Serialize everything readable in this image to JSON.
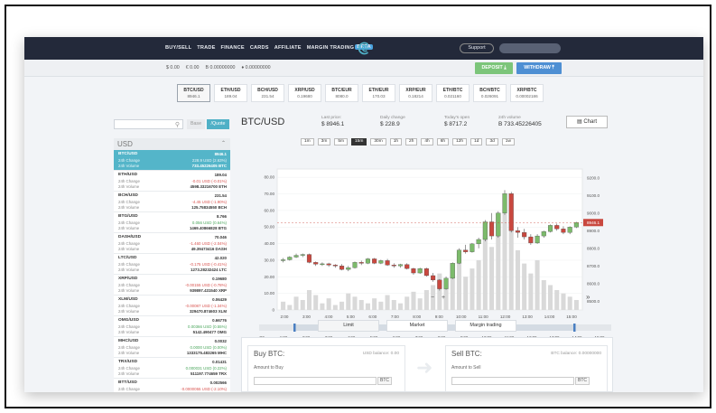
{
  "nav": {
    "items": [
      "BUY/SELL",
      "TRADE",
      "FINANCE",
      "CARDS",
      "AFFILIATE",
      "MARGIN TRADING"
    ],
    "beta": "BETA",
    "support": "Support"
  },
  "balances": [
    "$ 0.00",
    "€ 0.00",
    "B 0.00000000",
    "♦ 0.00000000"
  ],
  "deposit_label": "DEPOSIT",
  "withdraw_label": "WITHDRAW",
  "pairs": [
    {
      "name": "BTC/USD",
      "price": "8946.1"
    },
    {
      "name": "ETH/USD",
      "price": "189.04"
    },
    {
      "name": "BCH/USD",
      "price": "231.54"
    },
    {
      "name": "XRP/USD",
      "price": "0.19680"
    },
    {
      "name": "BTC/EUR",
      "price": "8080.0"
    },
    {
      "name": "ETH/EUR",
      "price": "170.03"
    },
    {
      "name": "XRP/EUR",
      "price": "0.18214"
    },
    {
      "name": "ETH/BTC",
      "price": "0.021160"
    },
    {
      "name": "BCH/BTC",
      "price": "0.026091"
    },
    {
      "name": "XRP/BTC",
      "price": "0.00002186"
    }
  ],
  "filter": {
    "base": "Base",
    "quote": "/Quote"
  },
  "market": {
    "header": "USD",
    "change_label": "24h Change",
    "volume_label": "24h Volume",
    "rows": [
      {
        "sym": "BTC/USD",
        "price": "8946.1",
        "chg": "228.9 USD (2.63%)",
        "vol": "733.45226405 BTC",
        "dir": "up"
      },
      {
        "sym": "ETH/USD",
        "price": "189.04",
        "chg": "-0.01 USD (-0.01%)",
        "vol": "4598.33216700 ETH",
        "dir": "down"
      },
      {
        "sym": "BCH/USD",
        "price": "231.54",
        "chg": "-4.45 USD (-1.90%)",
        "vol": "125.75834550 BCH",
        "dir": "down"
      },
      {
        "sym": "BTG/USD",
        "price": "8.766",
        "chg": "0.056 USD (0.64%)",
        "vol": "1469.40866828 BTG",
        "dir": "up"
      },
      {
        "sym": "DASH/USD",
        "price": "70.046",
        "chg": "-1.460 USD (-2.04%)",
        "vol": "49.39473416 DASH",
        "dir": "down"
      },
      {
        "sym": "LTC/USD",
        "price": "42.020",
        "chg": "-0.175 USD (-0.41%)",
        "vol": "1273.28232424 LTC",
        "dir": "down"
      },
      {
        "sym": "XRP/USD",
        "price": "0.19680",
        "chg": "-0.00155 USD (-0.78%)",
        "vol": "939897.431540 XRP",
        "dir": "down"
      },
      {
        "sym": "XLM/USD",
        "price": "0.06429",
        "chg": "-0.00087 USD (-1.34%)",
        "vol": "329470.874603 XLM",
        "dir": "down"
      },
      {
        "sym": "OMG/USD",
        "price": "0.66776",
        "chg": "0.00366 USD (0.55%)",
        "vol": "5142.490477 OMG",
        "dir": "up"
      },
      {
        "sym": "MHC/USD",
        "price": "0.0032",
        "chg": "0.0000 USD (0.00%)",
        "vol": "1333175.483265 MHC",
        "dir": "up"
      },
      {
        "sym": "TRX/USD",
        "price": "0.01431",
        "chg": "0.000031 USD (0.22%)",
        "vol": "511197.774659 TRX",
        "dir": "up"
      },
      {
        "sym": "BTT/USD",
        "price": "0.002566",
        "chg": "-0.0000055 USD (-2.10%)",
        "vol": "",
        "dir": "down"
      }
    ]
  },
  "ticker": {
    "title": "BTC/USD",
    "last_label": "Last price:",
    "last": "$ 8946.1",
    "daily_label": "Daily change",
    "daily": "$ 228.9",
    "open_label": "Today's open",
    "open": "$ 8717.2",
    "vol_label": "24h volume",
    "vol": "B 733.45226405",
    "chart_btn": "Chart"
  },
  "timeframes": [
    "1m",
    "3m",
    "5m",
    "15m",
    "30m",
    "1h",
    "2h",
    "4h",
    "6h",
    "12h",
    "1d",
    "3d",
    "1w"
  ],
  "active_timeframe": "15m",
  "chart_data": {
    "type": "candlestick",
    "left_axis_ticks": [
      "80.00",
      "70.00",
      "60.00",
      "50.00",
      "40.00",
      "30.00",
      "20.00",
      "10.00",
      "0"
    ],
    "right_axis_ticks": [
      "9200.0",
      "9100.0",
      "9000.0",
      "8900.0",
      "8800.0",
      "8700.0",
      "8600.0",
      "8500.0"
    ],
    "time_ticks": [
      "2:00",
      "3:00",
      "4:00",
      "5:00",
      "6:00",
      "7:00",
      "8:00",
      "9:00",
      "10:00",
      "11:00",
      "12:00",
      "13:00",
      "14:00",
      "15:00"
    ],
    "nav_ticks": [
      "-:00",
      "1:00",
      "2:00",
      "3:00",
      "4:00",
      "5:00",
      "6:00",
      "7:00",
      "8:00",
      "9:00",
      "10:00",
      "11:00",
      "12:00",
      "13:00",
      "14:00",
      "15:00"
    ],
    "price_label": "8946.1",
    "price_range": [
      8450,
      9250
    ],
    "volume_range": [
      0,
      85
    ],
    "ohlc": [
      [
        8730,
        8745,
        8720,
        8735
      ],
      [
        8735,
        8755,
        8730,
        8750
      ],
      [
        8750,
        8770,
        8745,
        8760
      ],
      [
        8760,
        8770,
        8750,
        8765
      ],
      [
        8765,
        8770,
        8715,
        8720
      ],
      [
        8720,
        8725,
        8700,
        8710
      ],
      [
        8710,
        8720,
        8700,
        8712
      ],
      [
        8712,
        8718,
        8695,
        8705
      ],
      [
        8705,
        8710,
        8690,
        8700
      ],
      [
        8700,
        8710,
        8675,
        8680
      ],
      [
        8680,
        8700,
        8670,
        8690
      ],
      [
        8690,
        8725,
        8685,
        8720
      ],
      [
        8720,
        8730,
        8705,
        8715
      ],
      [
        8715,
        8745,
        8710,
        8740
      ],
      [
        8740,
        8745,
        8710,
        8715
      ],
      [
        8715,
        8735,
        8710,
        8730
      ],
      [
        8730,
        8740,
        8700,
        8705
      ],
      [
        8705,
        8715,
        8690,
        8700
      ],
      [
        8700,
        8712,
        8690,
        8708
      ],
      [
        8708,
        8715,
        8680,
        8685
      ],
      [
        8685,
        8690,
        8650,
        8660
      ],
      [
        8660,
        8690,
        8655,
        8685
      ],
      [
        8685,
        8690,
        8640,
        8645
      ],
      [
        8645,
        8660,
        8610,
        8620
      ],
      [
        8620,
        8625,
        8560,
        8570
      ],
      [
        8570,
        8640,
        8565,
        8630
      ],
      [
        8630,
        8720,
        8625,
        8715
      ],
      [
        8715,
        8800,
        8710,
        8790
      ],
      [
        8790,
        8820,
        8770,
        8780
      ],
      [
        8780,
        8830,
        8775,
        8825
      ],
      [
        8825,
        8860,
        8800,
        8850
      ],
      [
        8850,
        8960,
        8840,
        8950
      ],
      [
        8950,
        9000,
        8850,
        8870
      ],
      [
        8870,
        9010,
        8860,
        9000
      ],
      [
        9000,
        9130,
        8990,
        9110
      ],
      [
        9110,
        9120,
        8890,
        8900
      ],
      [
        8900,
        8920,
        8860,
        8890
      ],
      [
        8890,
        8910,
        8850,
        8865
      ],
      [
        8865,
        8880,
        8820,
        8830
      ],
      [
        8830,
        8880,
        8825,
        8870
      ],
      [
        8870,
        8900,
        8860,
        8895
      ],
      [
        8895,
        8935,
        8890,
        8930
      ],
      [
        8930,
        8940,
        8900,
        8910
      ],
      [
        8910,
        8925,
        8880,
        8890
      ],
      [
        8890,
        8925,
        8880,
        8920
      ],
      [
        8920,
        8950,
        8915,
        8946.1
      ]
    ],
    "volumes": [
      5,
      3,
      8,
      6,
      12,
      9,
      4,
      7,
      3,
      5,
      10,
      8,
      6,
      4,
      7,
      5,
      9,
      6,
      4,
      8,
      11,
      7,
      12,
      15,
      22,
      18,
      28,
      34,
      20,
      25,
      30,
      45,
      38,
      52,
      70,
      48,
      36,
      28,
      22,
      30,
      18,
      15,
      12,
      10,
      8,
      6
    ]
  },
  "order_tabs": [
    "Limit",
    "Market",
    "Margin trading"
  ],
  "buy": {
    "title": "Buy BTC:",
    "balance": "USD balance: 0.00",
    "amount_label": "Amount to Buy",
    "unit": "BTC"
  },
  "sell": {
    "title": "Sell BTC:",
    "balance": "BTC balance: 0.00000000",
    "amount_label": "Amount to Sell",
    "unit": "BTC"
  }
}
